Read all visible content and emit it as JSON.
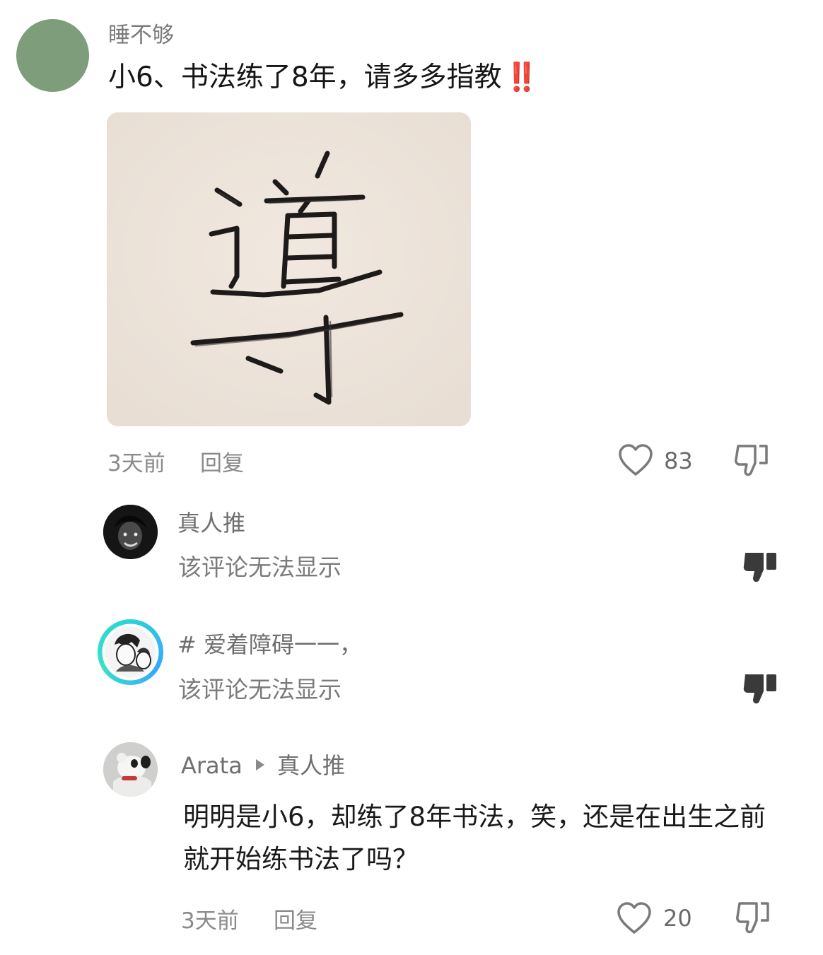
{
  "main_comment": {
    "username": "睡不够",
    "text": "小6、书法练了8年，请多多指教",
    "emoji": "‼️",
    "image_glyph": "導",
    "time": "3天前",
    "reply_label": "回复",
    "like_count": "83",
    "avatar_color": "#7d9d7b"
  },
  "replies": [
    {
      "username": "真人推",
      "text": "该评论无法显示"
    },
    {
      "username": "# 爱着障碍一一，",
      "text": "该评论无法显示"
    },
    {
      "username": "Arata",
      "reply_to": "真人推",
      "text": "明明是小6，却练了8年书法，笑，还是在出生之前就开始练书法了吗？",
      "time": "3天前",
      "reply_label": "回复",
      "like_count": "20"
    }
  ],
  "colors": {
    "alert_red": "#e8201c",
    "meta_gray": "#8a8a8a",
    "photo_background": "#efe5dc"
  }
}
